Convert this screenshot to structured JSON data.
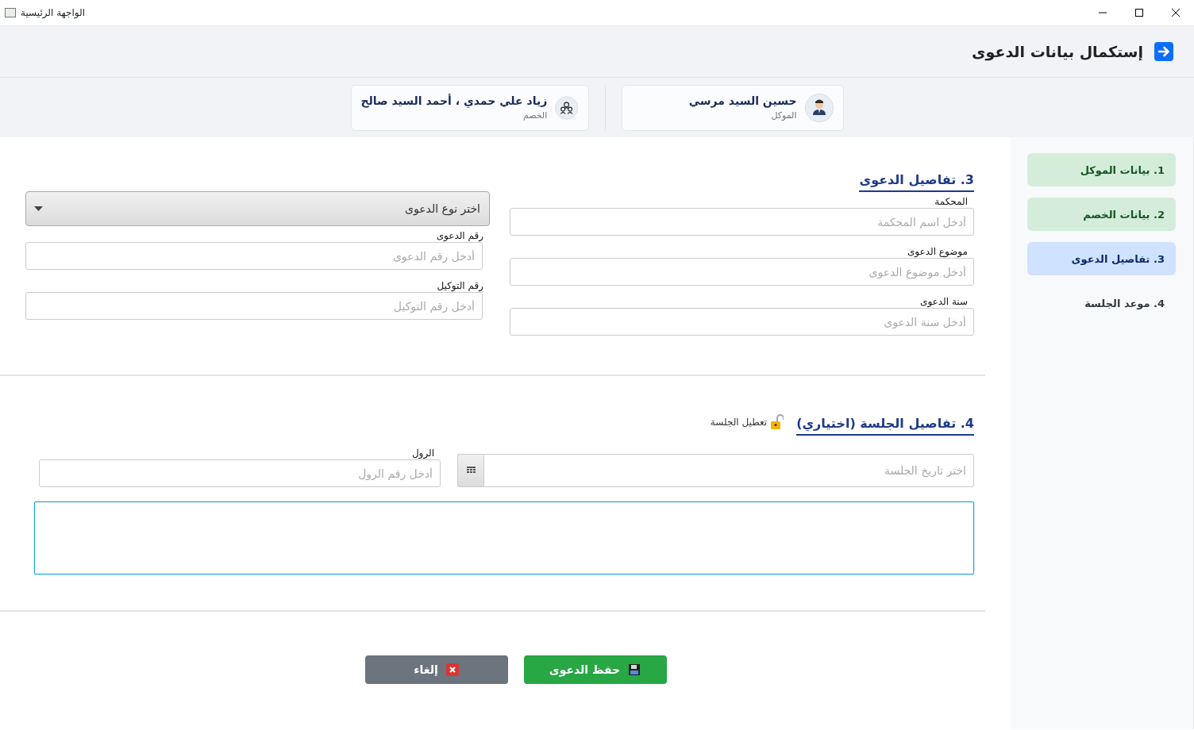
{
  "window": {
    "title": "الواجهة الرئيسية"
  },
  "header": {
    "title": "إستكمال بيانات الدعوى"
  },
  "parties": [
    {
      "kind": "client",
      "name": "حسين السيد مرسي",
      "role": "الموكل"
    },
    {
      "kind": "opponent",
      "name": "زياد علي حمدي ، أحمد السيد صالح",
      "role": "الخصم"
    }
  ],
  "steps": [
    {
      "label": "1. بيانات الموكل",
      "completed": true,
      "selected": false
    },
    {
      "label": "2. بيانات الخصم",
      "completed": true,
      "selected": false
    },
    {
      "label": "3. تفاصيل الدعوى",
      "completed": false,
      "selected": true
    },
    {
      "label": "4. موعد الجلسة",
      "completed": false,
      "selected": false
    }
  ],
  "case_section": {
    "title": "3. تفاصيل الدعوى",
    "right_fields": [
      {
        "label": "المحكمة",
        "placeholder": "أدخل اسم المحكمة"
      },
      {
        "label": "موضوع الدعوى",
        "placeholder": "أدخل موضوع الدعوى"
      },
      {
        "label": "سنة الدعوى",
        "placeholder": "أدخل سنة الدعوى"
      }
    ],
    "case_type": {
      "value": "اختر نوع الدعوى"
    },
    "left_fields": [
      {
        "label": "رقم الدعوى",
        "placeholder": "أدخل رقم الدعوى"
      },
      {
        "label": "رقم التوكيل",
        "placeholder": "أدخل رقم التوكيل"
      }
    ]
  },
  "session_section": {
    "title": "4. تفاصيل الجلسة (اختياري)",
    "toggle": {
      "label": "تعطيل الجلسة",
      "locked": false
    },
    "date_field": {
      "placeholder": "اختر تاريخ الجلسة"
    },
    "roll_field": {
      "label": "الرول",
      "placeholder": "أدخل رقم الرول"
    },
    "notes": {
      "focused": true
    }
  },
  "buttons": [
    {
      "kind": "save",
      "label": "حفظ الدعوى"
    },
    {
      "kind": "cancel",
      "label": "إلغاء"
    }
  ]
}
